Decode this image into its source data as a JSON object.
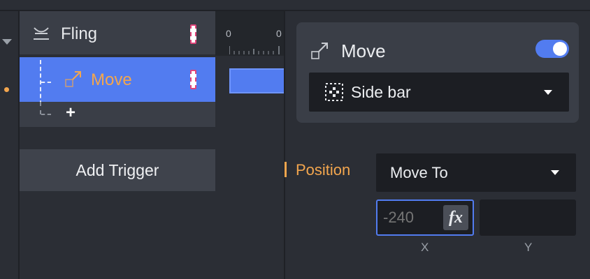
{
  "layers": {
    "fling": {
      "label": "Fling",
      "icon": "fling-gesture-icon"
    },
    "move": {
      "label": "Move",
      "icon": "move-arrow-icon"
    },
    "add_symbol": "+"
  },
  "add_trigger_label": "Add Trigger",
  "timeline": {
    "ruler_labels": [
      "0",
      "0"
    ]
  },
  "properties": {
    "title": "Move",
    "enabled": true,
    "target": {
      "label": "Side bar",
      "icon": "layer-target-icon"
    },
    "position": {
      "label": "Position",
      "mode": "Move To",
      "x_placeholder": "-240",
      "x_value": "",
      "y_value": "",
      "fx_label": "fx",
      "x_axis": "X",
      "y_axis": "Y"
    }
  },
  "colors": {
    "accent": "#527cf0",
    "highlight": "#f3a64e",
    "panel": "#3a3e47",
    "background": "#2b2e35",
    "field": "#1c1e23"
  }
}
